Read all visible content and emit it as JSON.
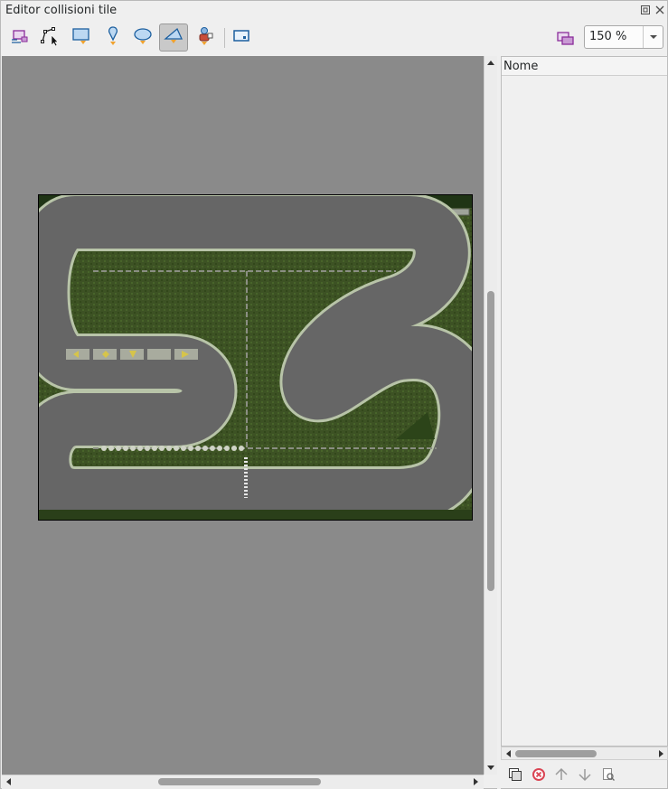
{
  "window": {
    "title": "Editor collisioni tile"
  },
  "toolbar": {
    "tools": [
      {
        "icon": "select-objects-icon"
      },
      {
        "icon": "edit-polygons-icon"
      },
      {
        "icon": "insert-rectangle-icon"
      },
      {
        "icon": "insert-point-icon"
      },
      {
        "icon": "insert-ellipse-icon"
      },
      {
        "icon": "insert-polygon-icon",
        "active": true
      },
      {
        "icon": "insert-template-icon"
      },
      {
        "icon": "insert-tile-icon"
      }
    ],
    "layer_icon": "objects-layer-icon",
    "zoom": "150 %"
  },
  "objects_panel": {
    "column_header": "Nome",
    "tools": [
      {
        "icon": "duplicate-icon"
      },
      {
        "icon": "remove-icon"
      },
      {
        "icon": "move-up-icon"
      },
      {
        "icon": "move-down-icon"
      },
      {
        "icon": "properties-icon"
      }
    ]
  },
  "colors": {
    "canvas_bg": "#8a8a8a",
    "grass": "#3f5524",
    "track": "#666666",
    "track_edge": "#b8c4a8"
  }
}
